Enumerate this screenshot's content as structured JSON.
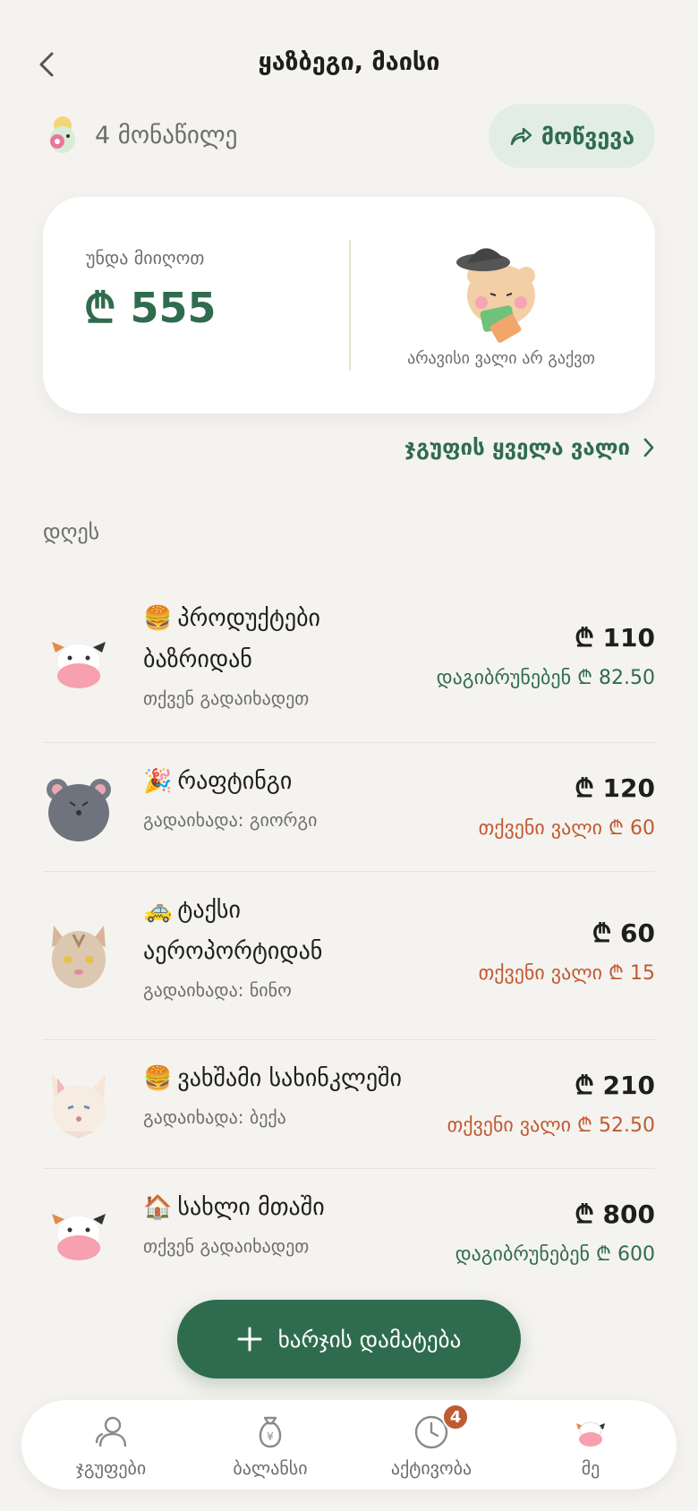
{
  "header": {
    "title": "ყაზბეგი, მაისი"
  },
  "members": {
    "count_label": "4 მონაწილე",
    "invite_label": "მოწვევა"
  },
  "balance": {
    "owed_label": "უნდა მიიღოთ",
    "owed_amount": "₾ 555",
    "no_debt_text": "არავისი ვალი არ გაქვთ"
  },
  "links": {
    "all_debts": "ჯგუფის ყველა ვალი"
  },
  "section": {
    "label": "დღეს"
  },
  "expenses": [
    {
      "emoji": "🍔",
      "title": "პროდუქტები ბაზრიდან",
      "subtitle": "თქვენ გადაიხადეთ",
      "total": "₾ 110",
      "status": "დაგიბრუნებენ ₾ 82.50",
      "status_type": "green",
      "avatar": "cow"
    },
    {
      "emoji": "🎉",
      "title": "რაფტინგი",
      "subtitle": "გადაიხადა: გიორგი",
      "total": "₾ 120",
      "status": "თქვენი ვალი ₾ 60",
      "status_type": "red",
      "avatar": "mouse"
    },
    {
      "emoji": "🚕",
      "title": "ტაქსი აეროპორტიდან",
      "subtitle": "გადაიხადა: ნინო",
      "total": "₾ 60",
      "status": "თქვენი ვალი ₾ 15",
      "status_type": "red",
      "avatar": "cat"
    },
    {
      "emoji": "🍔",
      "title": "ვახშამი სახინკლეში",
      "subtitle": "გადაიხადა: ბექა",
      "total": "₾ 210",
      "status": "თქვენი ვალი ₾ 52.50",
      "status_type": "red",
      "avatar": "fox"
    },
    {
      "emoji": "🏠",
      "title": "სახლი მთაში",
      "subtitle": "თქვენ გადაიხადეთ",
      "total": "₾ 800",
      "status": "დაგიბრუნებენ ₾ 600",
      "status_type": "green",
      "avatar": "cow"
    }
  ],
  "actions": {
    "add_expense": "ხარჯის დამატება"
  },
  "nav": {
    "groups": "ჯგუფები",
    "balance": "ბალანსი",
    "activity": "აქტივობა",
    "activity_badge": "4",
    "me": "მე"
  },
  "colors": {
    "accent": "#2f6c4e",
    "debt": "#c05a32",
    "background": "#f5f3ef"
  }
}
